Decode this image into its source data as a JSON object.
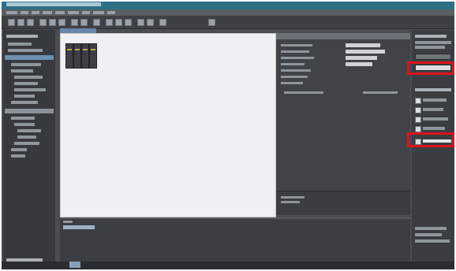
{
  "app": {
    "window": "engineering-software-editor"
  },
  "highlights": {
    "color": "#e0121c",
    "count": 2
  },
  "icons": {
    "toolbar": [
      "new-icon",
      "open-icon",
      "save-icon",
      "cut-icon",
      "copy-icon",
      "paste-icon",
      "undo-icon",
      "redo-icon",
      "delete-icon",
      "compile-icon",
      "download-icon",
      "upload-icon",
      "online-icon",
      "offline-icon",
      "monitor-icon",
      "search-icon"
    ]
  }
}
